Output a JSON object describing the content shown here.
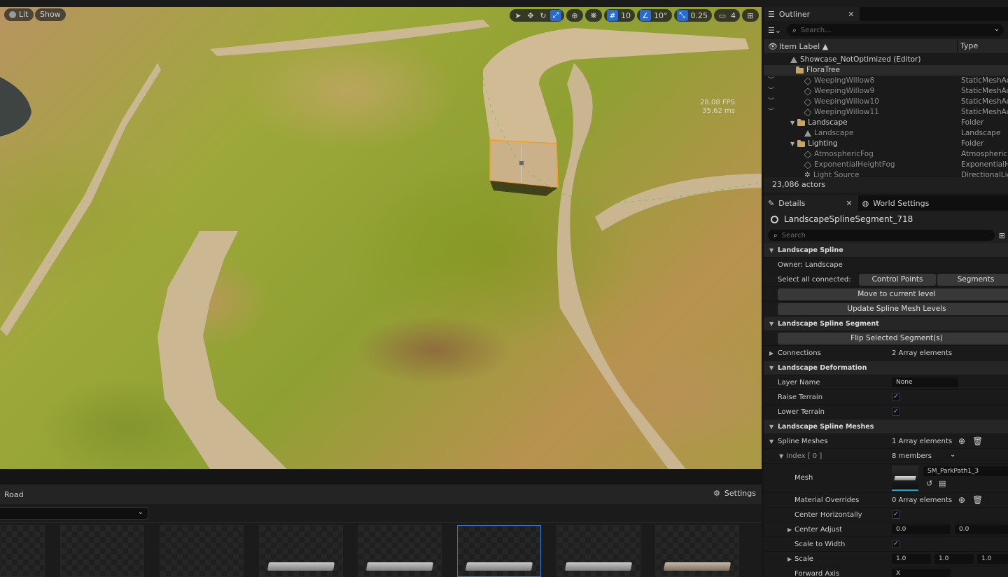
{
  "viewport": {
    "lit_label": "Lit",
    "show_label": "Show",
    "grid_snap": "10",
    "rotation_snap": "10°",
    "scale_snap": "0.25",
    "camera_speed": "4",
    "fps": "28.08 FPS",
    "ms": "35.62 ms"
  },
  "content_browser": {
    "title": "Road",
    "settings_label": "Settings",
    "selected_tile": 5
  },
  "outliner": {
    "tab_label": "Outliner",
    "search_placeholder": "Search...",
    "col_label": "Item Label ▲",
    "col_type": "Type",
    "rows": [
      {
        "name": "Showcase_NotOptimized (Editor)",
        "type": ""
      },
      {
        "name": "FloraTree",
        "type": ""
      },
      {
        "name": "WeepingWillow8",
        "type": "StaticMeshActor"
      },
      {
        "name": "WeepingWillow9",
        "type": "StaticMeshActor"
      },
      {
        "name": "WeepingWillow10",
        "type": "StaticMeshActor"
      },
      {
        "name": "WeepingWillow11",
        "type": "StaticMeshActor"
      },
      {
        "name": "Landscape",
        "type": "Folder"
      },
      {
        "name": "Landscape",
        "type": "Landscape"
      },
      {
        "name": "Lighting",
        "type": "Folder"
      },
      {
        "name": "AtmosphericFog",
        "type": "AtmosphericFog"
      },
      {
        "name": "ExponentialHeightFog",
        "type": "ExponentialHeightFog"
      },
      {
        "name": "Light Source",
        "type": "DirectionalLight"
      }
    ],
    "footer": "23,086 actors"
  },
  "details": {
    "tab_label": "Details",
    "world_settings_label": "World Settings",
    "object_name": "LandscapeSplineSegment_718",
    "search_placeholder": "Search",
    "sections": {
      "landscape_spline": "Landscape Spline",
      "owner": "Owner: Landscape",
      "select_all": "Select all connected:",
      "control_points": "Control Points",
      "segments": "Segments",
      "move_to_level": "Move to current level",
      "update_mesh_levels": "Update Spline Mesh Levels",
      "landscape_spline_segment": "Landscape Spline Segment",
      "flip_segments": "Flip Selected Segment(s)",
      "connections": "Connections",
      "connections_val": "2 Array elements",
      "landscape_deformation": "Landscape Deformation",
      "layer_name": "Layer Name",
      "layer_name_val": "None",
      "raise_terrain": "Raise Terrain",
      "lower_terrain": "Lower Terrain",
      "spline_meshes_cat": "Landscape Spline Meshes",
      "spline_meshes": "Spline Meshes",
      "spline_meshes_val": "1 Array elements",
      "index0": "Index [ 0 ]",
      "index0_val": "8 members",
      "mesh": "Mesh",
      "mesh_val": "SM_ParkPath1_3",
      "material_overrides": "Material Overrides",
      "material_overrides_val": "0 Array elements",
      "center_horizontally": "Center Horizontally",
      "center_adjust": "Center Adjust",
      "center_adjust_x": "0.0",
      "center_adjust_y": "0.0",
      "scale_to_width": "Scale to Width",
      "scale": "Scale",
      "scale_x": "1.0",
      "scale_y": "1.0",
      "scale_z": "1.0",
      "forward_axis": "Forward Axis",
      "forward_axis_val": "X"
    }
  }
}
